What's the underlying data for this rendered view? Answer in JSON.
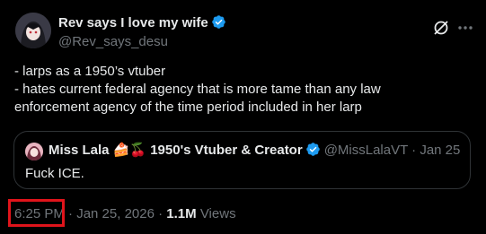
{
  "author": {
    "display_name": "Rev says I love my wife",
    "handle": "@Rev_says_desu",
    "verified": true,
    "avatar_icon": "anime-avatar-icon"
  },
  "actions": {
    "grok_icon": "grok-icon",
    "more_icon": "more-options-icon"
  },
  "post": {
    "lines": [
      "- larps as a 1950’s vtuber",
      "- hates current federal agency that is more tame than any law",
      "enforcement agency of the time period included in her larp"
    ]
  },
  "quote": {
    "display_name": "Miss Lala 🍰🍒 1950's Vtuber & Creator",
    "handle_and_date": "@MissLalaVT · Jan 25",
    "text": "Fuck ICE."
  },
  "meta": {
    "time": "6:25 PM",
    "date": "· Jan 25, 2026 ·",
    "views_count": "1.1M",
    "views_label": "Views"
  },
  "colors": {
    "background": "#000000",
    "text": "#e7e9ea",
    "muted": "#71767b",
    "verified_blue": "#1d9bf0",
    "highlight_red": "#e0141b",
    "border": "#2f3336"
  }
}
